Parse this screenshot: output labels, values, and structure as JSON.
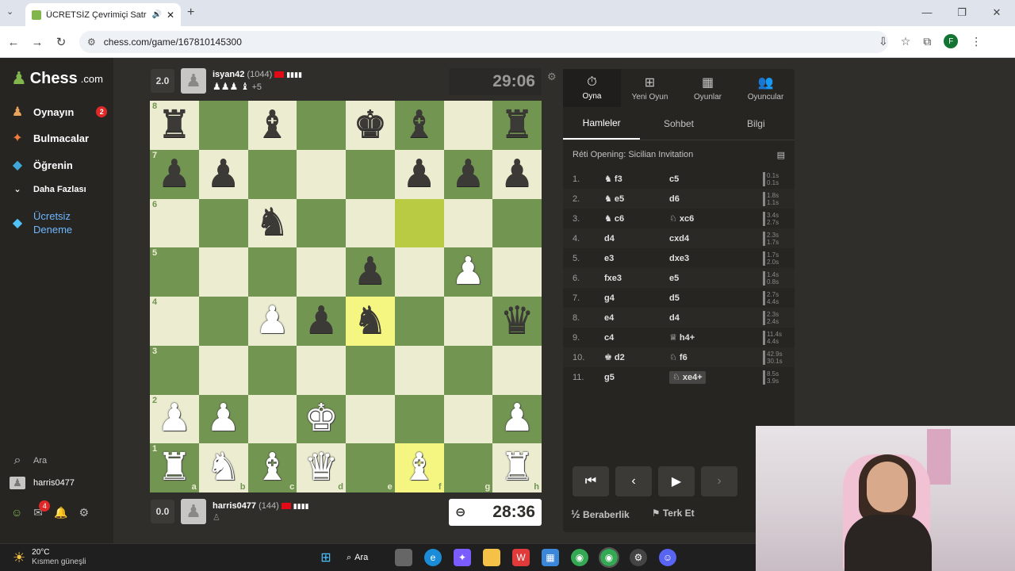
{
  "browser": {
    "tab_title": "ÜCRETSİZ Çevrimiçi Satranç",
    "url": "chess.com/game/167810145300",
    "profile_initial": "F"
  },
  "sidebar": {
    "logo": "Chess",
    "logo_suffix": ".com",
    "items": [
      {
        "label": "Oynayın",
        "badge": "2",
        "icon": "pawn-icon"
      },
      {
        "label": "Bulmacalar",
        "icon": "puzzle-icon"
      },
      {
        "label": "Öğrenin",
        "icon": "learn-icon"
      },
      {
        "label": "Daha Fazlası",
        "icon": "chevron-down-icon"
      },
      {
        "label": "Ücretsiz Deneme",
        "icon": "diamond-icon"
      }
    ],
    "search_label": "Ara",
    "username": "harris0477",
    "mail_badge": "4"
  },
  "top_player": {
    "score": "2.0",
    "name": "isyan42",
    "rating": "(1044)",
    "captured": "♟♟♟ ♝",
    "advantage": "+5",
    "clock": "29:06"
  },
  "bottom_player": {
    "score": "0.0",
    "name": "harris0477",
    "rating": "(144)",
    "clock": "28:36"
  },
  "board": {
    "ranks": [
      "8",
      "7",
      "6",
      "5",
      "4",
      "3",
      "2",
      "1"
    ],
    "files": [
      "a",
      "b",
      "c",
      "d",
      "e",
      "f",
      "g",
      "h"
    ],
    "rows": [
      [
        "r",
        "",
        "b",
        "",
        "k",
        "b",
        "",
        "r"
      ],
      [
        "p",
        "p",
        "",
        "",
        "",
        "p",
        "p",
        "p"
      ],
      [
        "",
        "",
        "n",
        "",
        "",
        "",
        "",
        ""
      ],
      [
        "",
        "",
        "",
        "",
        "p",
        "",
        "P",
        ""
      ],
      [
        "",
        "",
        "P",
        "p",
        "n",
        "",
        "",
        "q"
      ],
      [
        "",
        "",
        "",
        "",
        "",
        "",
        "",
        ""
      ],
      [
        "P",
        "P",
        "",
        "K",
        "",
        "",
        "",
        "P"
      ],
      [
        "R",
        "N",
        "B",
        "Q",
        "",
        "B",
        "",
        "R"
      ]
    ],
    "highlights": [
      "f6",
      "e4",
      "f1"
    ]
  },
  "panel": {
    "tabs": [
      {
        "label": "Oyna",
        "icon": "stopwatch-icon"
      },
      {
        "label": "Yeni Oyun",
        "icon": "plus-icon"
      },
      {
        "label": "Oyunlar",
        "icon": "board-icon"
      },
      {
        "label": "Oyuncular",
        "icon": "players-icon"
      }
    ],
    "subtabs": [
      "Hamleler",
      "Sohbet",
      "Bilgi"
    ],
    "opening": "Réti Opening: Sicilian Invitation",
    "moves": [
      {
        "n": "1.",
        "w": "♞ f3",
        "b": "c5",
        "tw": "0.1s",
        "tb": "0.1s"
      },
      {
        "n": "2.",
        "w": "♞ e5",
        "b": "d6",
        "tw": "1.8s",
        "tb": "1.1s"
      },
      {
        "n": "3.",
        "w": "♞ c6",
        "b": "♘ xc6",
        "tw": "3.4s",
        "tb": "2.7s"
      },
      {
        "n": "4.",
        "w": "d4",
        "b": "cxd4",
        "tw": "2.3s",
        "tb": "1.7s"
      },
      {
        "n": "5.",
        "w": "e3",
        "b": "dxe3",
        "tw": "1.7s",
        "tb": "2.0s"
      },
      {
        "n": "6.",
        "w": "fxe3",
        "b": "e5",
        "tw": "1.4s",
        "tb": "0.8s"
      },
      {
        "n": "7.",
        "w": "g4",
        "b": "d5",
        "tw": "2.7s",
        "tb": "4.4s"
      },
      {
        "n": "8.",
        "w": "e4",
        "b": "d4",
        "tw": "2.3s",
        "tb": "2.4s"
      },
      {
        "n": "9.",
        "w": "c4",
        "b": "♕ h4+",
        "tw": "11.4s",
        "tb": "4.4s"
      },
      {
        "n": "10.",
        "w": "♚ d2",
        "b": "♘ f6",
        "tw": "42.9s",
        "tb": "30.1s"
      },
      {
        "n": "11.",
        "w": "g5",
        "b": "♘ xe4+",
        "tw": "8.5s",
        "tb": "3.9s"
      }
    ],
    "draw_label": "Beraberlik",
    "draw_prefix": "½",
    "resign_label": "Terk Et"
  },
  "taskbar": {
    "temp": "20°C",
    "weather": "Kısmen güneşli",
    "search": "Ara"
  }
}
